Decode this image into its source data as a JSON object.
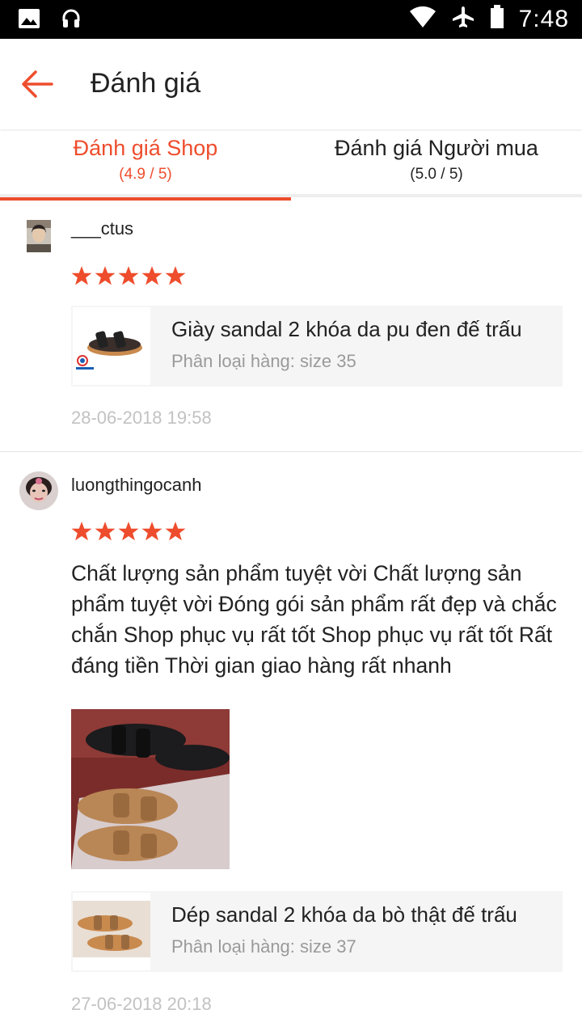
{
  "status_bar": {
    "time": "7:48"
  },
  "header": {
    "title": "Đánh giá"
  },
  "tabs": [
    {
      "label": "Đánh giá Shop",
      "score": "(4.9 / 5)"
    },
    {
      "label": "Đánh giá Người mua",
      "score": "(5.0 / 5)"
    }
  ],
  "reviews": [
    {
      "username": "___ctus",
      "rating": 5,
      "product": {
        "name": "Giày sandal 2 khóa da pu đen đế trấu",
        "variant": "Phân loại hàng: size 35"
      },
      "date": "28-06-2018 19:58"
    },
    {
      "username": "luongthingocanh",
      "rating": 5,
      "comment": "Chất lượng sản phẩm tuyệt vời Chất lượng sản phẩm tuyệt vời Đóng gói sản phẩm rất đẹp và chắc chắn Shop phục vụ rất tốt Shop phục vụ rất tốt Rất đáng tiền Thời gian giao hàng rất nhanh",
      "product": {
        "name": "Dép sandal 2 khóa da bò thật đế trấu",
        "variant": "Phân loại hàng: size 37"
      },
      "date": "27-06-2018 20:18"
    }
  ],
  "colors": {
    "accent": "#ee4d2d",
    "star": "#ee4d2d",
    "muted": "#9a9a9a"
  }
}
